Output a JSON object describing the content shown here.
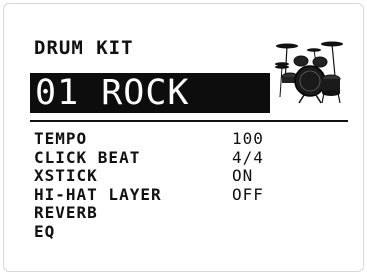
{
  "header": {
    "title": "DRUM KIT",
    "kit_name": "01 ROCK",
    "kit_icon": "drum-kit-icon"
  },
  "params": [
    {
      "label": "TEMPO",
      "value": "100"
    },
    {
      "label": "CLICK BEAT",
      "value": "4/4"
    },
    {
      "label": "XSTICK",
      "value": "ON"
    },
    {
      "label": "HI-HAT LAYER",
      "value": "OFF"
    },
    {
      "label": "REVERB",
      "value": ""
    },
    {
      "label": "EQ",
      "value": ""
    }
  ],
  "colors": {
    "highlight_bg": "#0d0d0d",
    "highlight_fg": "#ffffff",
    "text": "#111111"
  }
}
